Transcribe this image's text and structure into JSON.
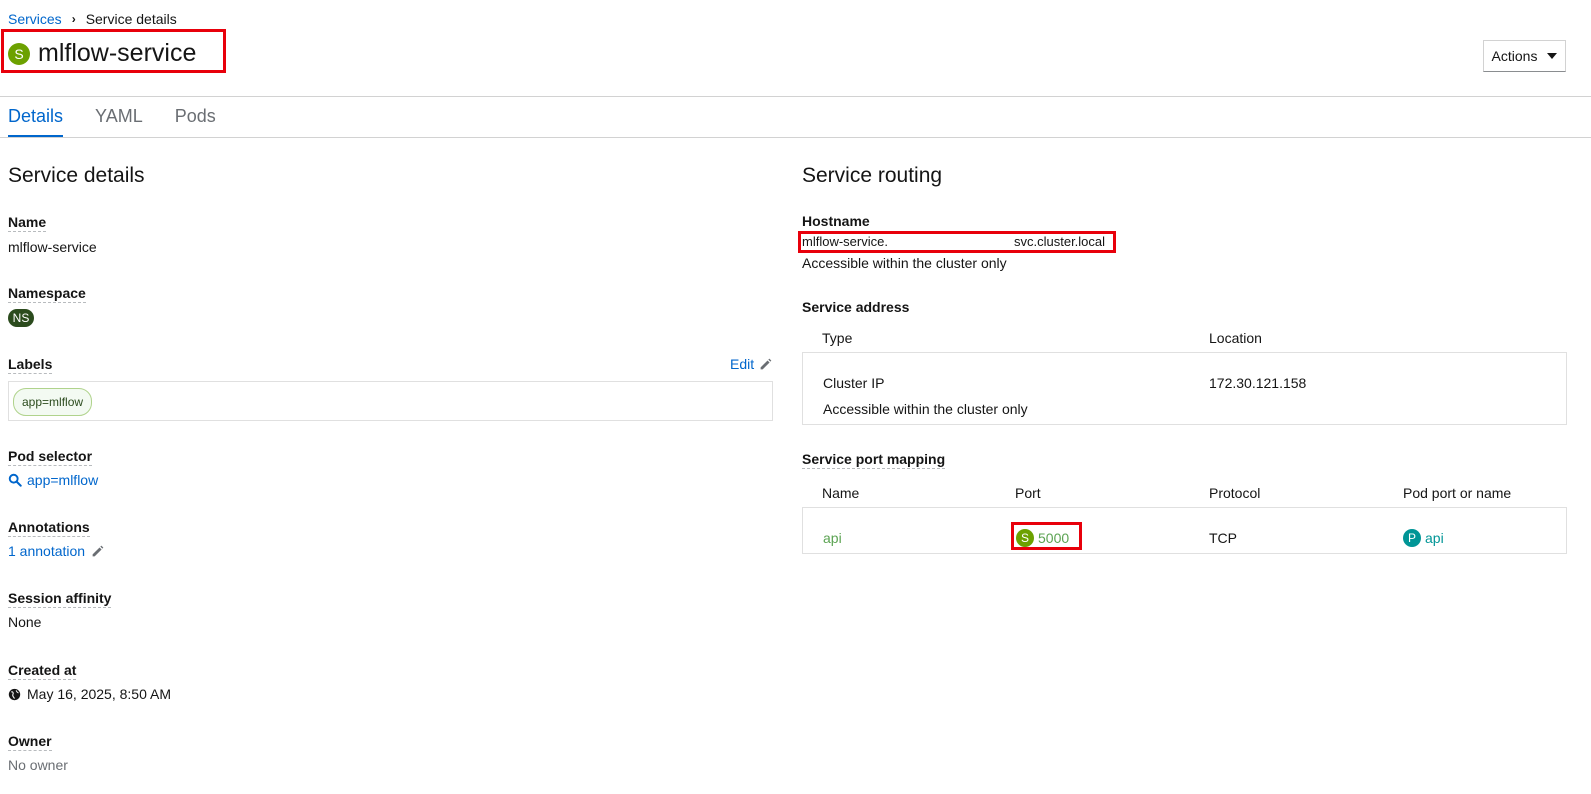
{
  "breadcrumb": {
    "parent": "Services",
    "current": "Service details"
  },
  "header": {
    "badge": "S",
    "title": "mlflow-service",
    "actions_label": "Actions"
  },
  "tabs": [
    {
      "label": "Details",
      "active": true
    },
    {
      "label": "YAML",
      "active": false
    },
    {
      "label": "Pods",
      "active": false
    }
  ],
  "details": {
    "heading": "Service details",
    "name_label": "Name",
    "name_value": "mlflow-service",
    "namespace_label": "Namespace",
    "namespace_badge": "NS",
    "labels_label": "Labels",
    "edit_label": "Edit",
    "label_chip": "app=mlflow",
    "pod_selector_label": "Pod selector",
    "pod_selector_value": "app=mlflow",
    "annotations_label": "Annotations",
    "annotations_value": "1 annotation",
    "session_affinity_label": "Session affinity",
    "session_affinity_value": "None",
    "created_label": "Created at",
    "created_value": "May 16, 2025, 8:50 AM",
    "owner_label": "Owner",
    "owner_value": "No owner"
  },
  "routing": {
    "heading": "Service routing",
    "hostname_label": "Hostname",
    "hostname_prefix": "mlflow-service.",
    "hostname_suffix": "svc.cluster.local",
    "hostname_note": "Accessible within the cluster only",
    "address_label": "Service address",
    "address_columns": {
      "type": "Type",
      "location": "Location"
    },
    "address_row": {
      "type": "Cluster IP",
      "note": "Accessible within the cluster only",
      "location": "172.30.121.158"
    },
    "port_mapping_label": "Service port mapping",
    "port_columns": {
      "name": "Name",
      "port": "Port",
      "protocol": "Protocol",
      "pod_port": "Pod port or name"
    },
    "port_row": {
      "name": "api",
      "port_badge": "S",
      "port": "5000",
      "protocol": "TCP",
      "pod_port_badge": "P",
      "pod_port": "api"
    }
  },
  "colors": {
    "link": "#0066cc",
    "highlight": "#e8000b",
    "service_badge": "#6ca100",
    "namespace_badge": "#2b4b1d",
    "pod_badge": "#009596"
  }
}
